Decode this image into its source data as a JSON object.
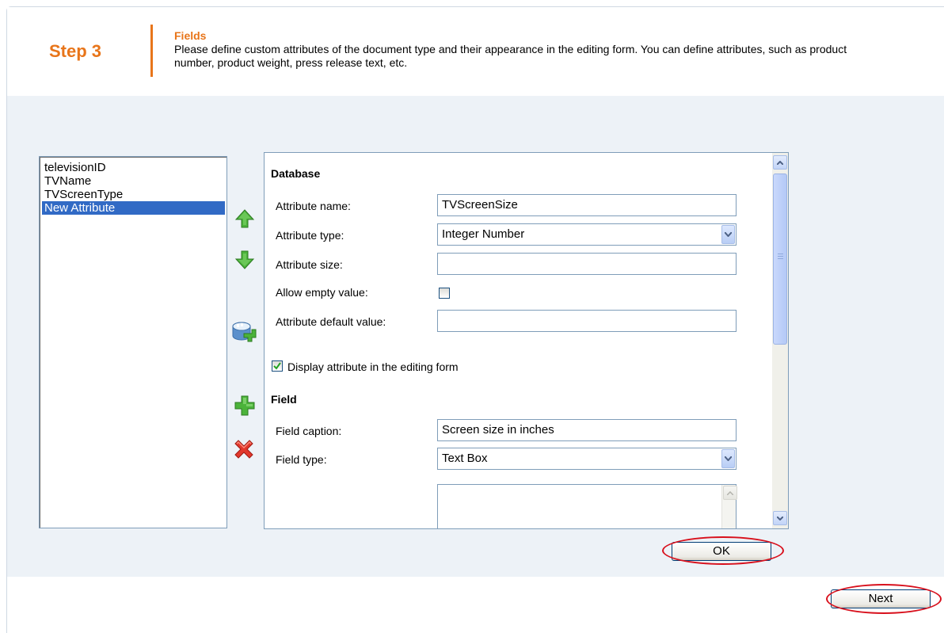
{
  "header": {
    "step": "Step 3",
    "section_title": "Fields",
    "section_description": "Please define custom attributes of the document type and their appearance in the editing form. You can define attributes, such as product number, product weight, press release text, etc."
  },
  "attribute_list": {
    "items": [
      "televisionID",
      "TVName",
      "TVScreenType",
      "New Attribute"
    ],
    "selected": "New Attribute"
  },
  "side_toolbar": {
    "icons": [
      "move-up-arrow",
      "move-down-arrow",
      "new-database-attribute",
      "new-field",
      "delete"
    ]
  },
  "form": {
    "database_heading": "Database",
    "attribute_name_label": "Attribute name:",
    "attribute_name_value": "TVScreenSize",
    "attribute_type_label": "Attribute type:",
    "attribute_type_value": "Integer Number",
    "attribute_size_label": "Attribute size:",
    "attribute_size_value": "",
    "allow_empty_label": "Allow empty value:",
    "allow_empty_checked": false,
    "default_value_label": "Attribute default value:",
    "default_value_value": "",
    "display_in_form_label": "Display attribute in the editing form",
    "display_in_form_checked": true,
    "field_heading": "Field",
    "field_caption_label": "Field caption:",
    "field_caption_value": "Screen size in inches",
    "field_type_label": "Field type:",
    "field_type_value": "Text Box"
  },
  "buttons": {
    "ok_label": "OK",
    "next_label": "Next"
  },
  "colors": {
    "accent_orange": "#e8751a",
    "content_bg": "#edf2f7",
    "selection_blue": "#316ac5",
    "highlight_red": "#d8101c"
  }
}
